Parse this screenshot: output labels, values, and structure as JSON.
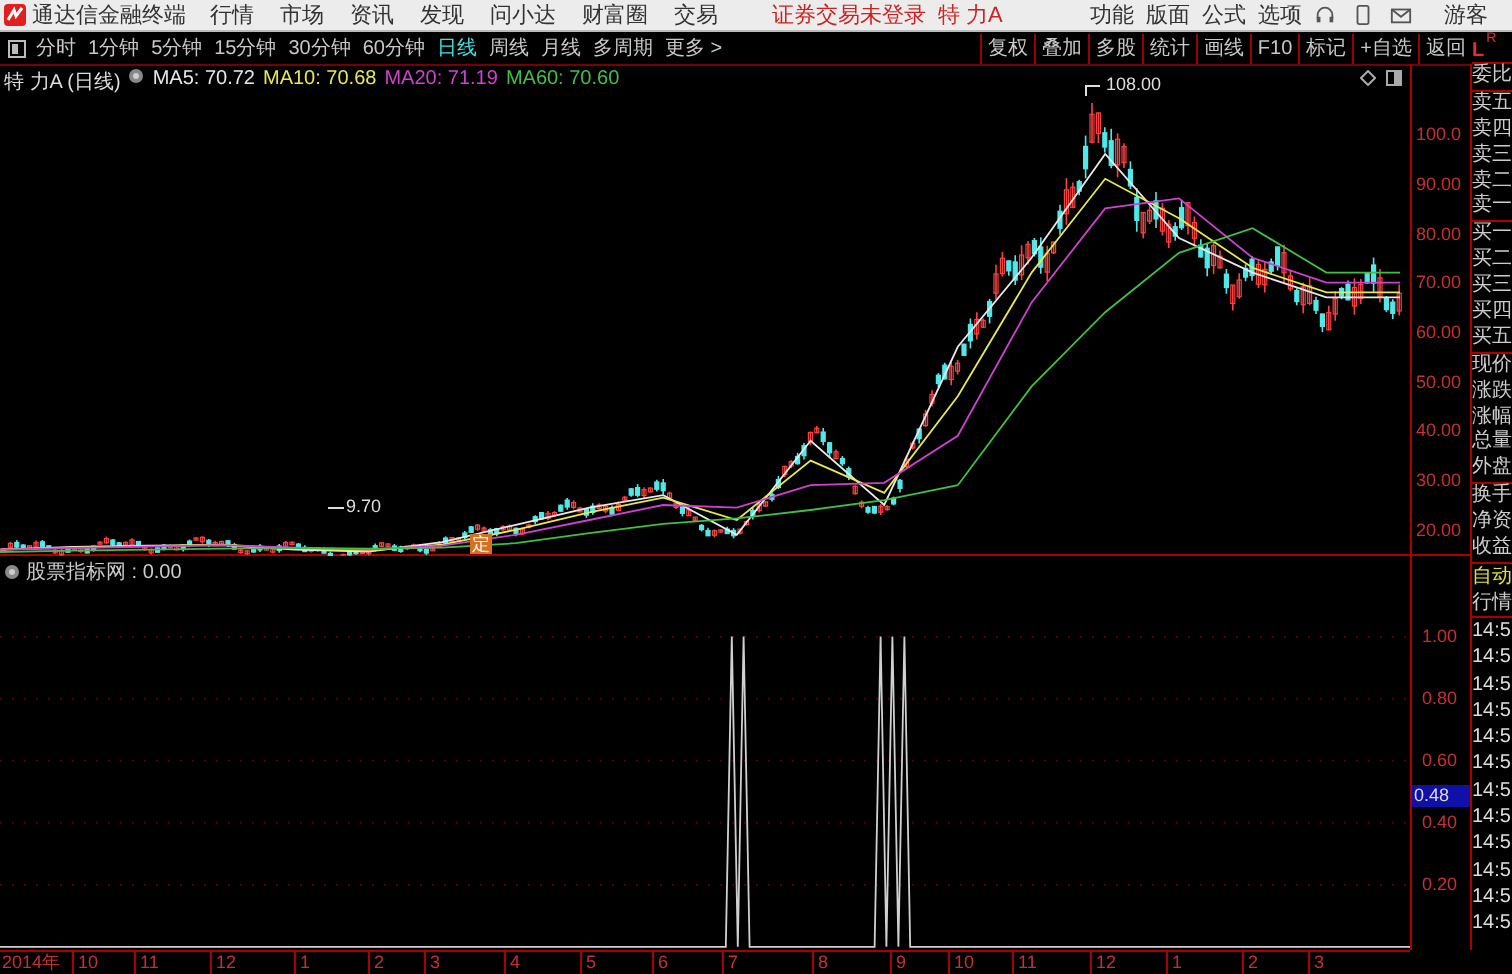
{
  "menu_bar": {
    "app_title": "通达信金融终端",
    "menus": [
      "行情",
      "市场",
      "资讯",
      "发现",
      "问小达",
      "财富圈",
      "交易"
    ],
    "login_status": "证券交易未登录",
    "stock_name": "特 力A",
    "right_menus": [
      "功能",
      "版面",
      "公式",
      "选项"
    ],
    "user": "游客"
  },
  "period_tabs": [
    {
      "label": "分时",
      "selected": false
    },
    {
      "label": "1分钟",
      "selected": false
    },
    {
      "label": "5分钟",
      "selected": false
    },
    {
      "label": "15分钟",
      "selected": false
    },
    {
      "label": "30分钟",
      "selected": false
    },
    {
      "label": "60分钟",
      "selected": false
    },
    {
      "label": "日线",
      "selected": true
    },
    {
      "label": "周线",
      "selected": false
    },
    {
      "label": "月线",
      "selected": false
    },
    {
      "label": "多周期",
      "selected": false
    },
    {
      "label": "更多 >",
      "selected": false
    }
  ],
  "tool_buttons": [
    "复权",
    "叠加",
    "多股",
    "统计",
    "画线",
    "F10",
    "标记",
    "+自选",
    "返回"
  ],
  "chart": {
    "title": "特 力A (日线)",
    "ma": [
      "MA5: 70.72",
      "MA10: 70.68",
      "MA20: 71.19",
      "MA60: 70.60"
    ],
    "high_label": "108.00",
    "low_label": "9.70",
    "marker": "定",
    "chart_data": {
      "type": "line",
      "ylim": [
        14.7,
        114.2
      ],
      "yticks": [
        {
          "value": 100,
          "label": "100.0"
        },
        {
          "value": 90,
          "label": "90.00"
        },
        {
          "value": 80,
          "label": "80.00"
        },
        {
          "value": 70,
          "label": "70.00"
        },
        {
          "value": 60,
          "label": "60.00"
        },
        {
          "value": 50,
          "label": "50.00"
        },
        {
          "value": 40,
          "label": "40.00"
        },
        {
          "value": 30,
          "label": "30.00"
        },
        {
          "value": 20,
          "label": "20.00"
        }
      ],
      "series": [
        {
          "color": "#e8e8e8",
          "values": [
            16,
            16.5,
            16.8,
            16.9,
            16,
            15.6,
            17.5,
            21,
            24.5,
            27,
            19,
            38,
            25,
            57,
            75,
            96,
            79,
            72,
            67,
            67
          ]
        },
        {
          "color": "#e8e850",
          "values": [
            16,
            16.4,
            16.7,
            17,
            16.2,
            15.8,
            17,
            20,
            23.5,
            26.5,
            22,
            34,
            27.5,
            47,
            72,
            91,
            83,
            73,
            68,
            68
          ]
        },
        {
          "color": "#d040d0",
          "values": [
            16,
            16.3,
            16.6,
            16.9,
            16.4,
            16,
            16.8,
            19,
            22,
            25,
            24.5,
            29,
            29.5,
            39,
            66,
            85,
            87,
            75,
            70,
            70
          ]
        },
        {
          "color": "#40c040",
          "values": [
            15.5,
            15.8,
            16,
            16.2,
            16.3,
            16.2,
            16.4,
            17.3,
            19.3,
            21.2,
            22.3,
            24,
            26,
            29,
            49,
            64,
            76,
            81,
            72,
            72
          ]
        }
      ]
    }
  },
  "indicator": {
    "title": "股票指标网 : 0.00",
    "cursor_value": "0.48",
    "chart_data": {
      "type": "line",
      "grid": true,
      "ylim": [
        -0.01,
        1.26
      ],
      "yticks": [
        {
          "value": 1,
          "label": "1.00"
        },
        {
          "value": 0.8,
          "label": "0.80"
        },
        {
          "value": 0.6,
          "label": "0.60"
        },
        {
          "value": 0.4,
          "label": "0.40"
        },
        {
          "value": 0.2,
          "label": "0.20"
        }
      ],
      "series": [
        {
          "color": "#d0d0d0",
          "values": [
            0,
            0,
            0,
            0,
            0,
            0,
            0,
            0,
            0,
            0,
            0,
            0,
            0,
            0,
            0,
            0,
            0,
            0,
            0,
            0,
            0,
            0,
            0,
            0,
            0,
            0,
            0,
            0,
            0,
            0,
            0,
            0,
            0,
            0,
            0,
            0,
            0,
            0,
            0,
            0,
            0,
            0,
            0,
            0,
            0,
            0,
            0,
            0,
            0,
            0,
            0,
            0,
            0,
            0,
            0,
            0,
            0,
            0,
            0,
            0,
            0,
            0,
            0,
            0,
            0,
            0,
            0,
            0,
            0,
            0,
            0,
            0,
            0,
            0,
            0,
            0,
            0,
            0,
            0,
            0,
            0,
            0,
            0,
            0,
            0,
            0,
            0,
            0,
            0,
            0,
            0,
            0,
            0,
            0,
            0,
            0,
            0,
            0,
            0,
            0,
            0,
            0,
            0,
            0,
            0,
            0,
            0,
            0,
            0,
            0,
            0,
            0,
            0,
            0,
            0,
            0,
            0,
            0,
            0,
            0,
            0,
            0,
            0,
            1,
            0,
            1,
            0,
            0,
            0,
            0,
            0,
            0,
            0,
            0,
            0,
            0,
            0,
            0,
            0,
            0,
            0,
            0,
            0,
            0,
            0,
            0,
            0,
            0,
            1,
            0,
            1,
            0,
            1,
            0,
            0,
            0,
            0,
            0,
            0,
            0,
            0,
            0,
            0,
            0,
            0,
            0,
            0,
            0,
            0,
            0,
            0,
            0,
            0,
            0,
            0,
            0,
            0,
            0,
            0,
            0,
            0,
            0,
            0,
            0,
            0,
            0,
            0,
            0,
            0,
            0,
            0,
            0,
            0,
            0,
            0,
            0,
            0,
            0,
            0,
            0,
            0,
            0,
            0,
            0,
            0,
            0,
            0,
            0,
            0,
            0,
            0,
            0,
            0,
            0,
            0,
            0,
            0,
            0,
            0,
            0,
            0,
            0,
            0,
            0,
            0,
            0,
            0,
            0,
            0,
            0,
            0,
            0,
            0,
            0,
            0,
            0,
            0,
            0
          ]
        }
      ]
    }
  },
  "time_axis": [
    "2014年",
    "10",
    "11",
    "12",
    "1",
    "2",
    "3",
    "4",
    "5",
    "6",
    "7",
    "8",
    "9",
    "10",
    "11",
    "12",
    "1",
    "2",
    "3"
  ],
  "quote_panel": {
    "header": "L",
    "header_sub": "R",
    "groups": [
      [
        "委比"
      ],
      [
        "卖五",
        "卖四",
        "卖三",
        "卖二",
        "卖一"
      ],
      [
        "买一",
        "买二",
        "买三",
        "买四",
        "买五"
      ],
      [
        "现价",
        "涨跌",
        "涨幅",
        "总量",
        "外盘"
      ],
      [
        "换手",
        "净资",
        "收益"
      ]
    ],
    "mode": "自动",
    "section": "行情",
    "trades": [
      "14:5",
      "14:5",
      "14:5",
      "14:5",
      "14:5",
      "14:5",
      "14:5",
      "14:5",
      "14:5",
      "14:5",
      "14:5",
      "14:5"
    ]
  }
}
